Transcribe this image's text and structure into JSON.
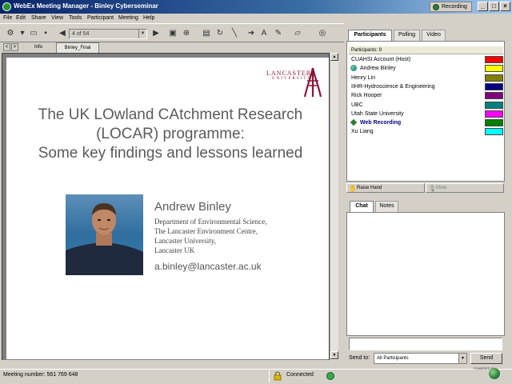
{
  "window": {
    "title": "WebEx Meeting Manager - Binley Cyberseminar",
    "recording_label": "Recording"
  },
  "menu": [
    "File",
    "Edit",
    "Share",
    "View",
    "Tools",
    "Participant",
    "Meeting",
    "Help"
  ],
  "toolbar": {
    "page_indicator": "4 of 54"
  },
  "doc_tabs": [
    "Info",
    "Binley_Final"
  ],
  "slide": {
    "logo_text_1": "LANCASTER",
    "logo_text_2": "UNIVERSITY",
    "title_line_1": "The UK LOwland CAtchment Research",
    "title_line_2": "(LOCAR) programme:",
    "title_line_3": "Some key findings and lessons learned",
    "presenter_name": "Andrew  Binley",
    "dept_lines": [
      "Department of Environmental Science,",
      "The Lancaster Environment Centre,",
      "Lancaster University,",
      "Lancaster UK"
    ],
    "email": "a.binley@lancaster.ac.uk"
  },
  "status": {
    "meeting_number": "Meeting number: 561 769 648",
    "connection": "Connected"
  },
  "panel_tabs": [
    "Participants",
    "Polling",
    "Video"
  ],
  "participants": {
    "count_label": "Participants: 9",
    "list": [
      {
        "name": "CUAHSI Account (Host)",
        "color": "#ff0000",
        "icon": "",
        "bold": false
      },
      {
        "name": "Andrew Binley",
        "color": "#ffff00",
        "icon": "globe-icon",
        "bold": false
      },
      {
        "name": "Henry Lin",
        "color": "#808000",
        "icon": "",
        "bold": false
      },
      {
        "name": "IIHR-Hydroscience & Engineering",
        "color": "#000080",
        "icon": "",
        "bold": false
      },
      {
        "name": "Rick Hooper",
        "color": "#800080",
        "icon": "",
        "bold": false
      },
      {
        "name": "UBC",
        "color": "#008080",
        "icon": "",
        "bold": false
      },
      {
        "name": "Utah State University",
        "color": "#ff00ff",
        "icon": "",
        "bold": false
      },
      {
        "name": "Web Recording",
        "color": "#008000",
        "icon": "diamond-icon",
        "bold": true
      },
      {
        "name": "Xu Liang",
        "color": "#00ffff",
        "icon": "",
        "bold": false
      }
    ]
  },
  "actions": {
    "raise_hand": "Raise Hand",
    "mute": "Mute"
  },
  "chat_tabs": [
    "Chat",
    "Notes"
  ],
  "send": {
    "label": "Send to:",
    "recipient": "All Participants",
    "button": "Send"
  },
  "powered_by": "POWERED BY"
}
